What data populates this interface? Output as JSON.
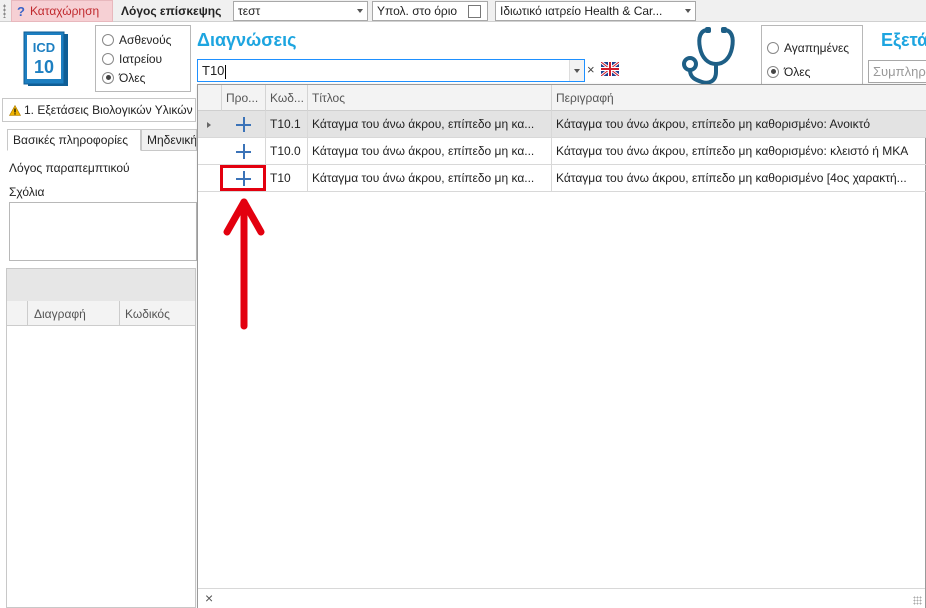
{
  "toolbar": {
    "register_label": "Καταχώρηση",
    "visit_reason_label": "Λόγος επίσκεψης",
    "visit_reason_value": "τεστ",
    "limit_label": "Υπολ. στο όριο",
    "clinic_value": "Ιδιωτικό ιατρείο Health & Car..."
  },
  "icd": {
    "logo_line1": "ICD",
    "logo_line2": "10",
    "filter_options": [
      "Ασθενούς",
      "Ιατρείου",
      "Όλες"
    ],
    "filter_selected": "Όλες",
    "title": "Διαγνώσεις",
    "search_value": "T10",
    "clear_symbol": "×"
  },
  "exams": {
    "filter_options": [
      "Αγαπημένες",
      "Όλες"
    ],
    "filter_selected": "Όλες",
    "title": "Εξετάσ",
    "search_placeholder": "Συμπληρ"
  },
  "left_panel": {
    "tab_label": "1. Εξετάσεις Βιολογικών Υλικών",
    "subtabs": [
      "Βασικές πληροφορίες",
      "Μηδενική"
    ],
    "referral_reason_label": "Λόγος παραπεμπτικού",
    "comments_label": "Σχόλια",
    "grid_columns": [
      "Διαγραφή",
      "Κωδικός"
    ]
  },
  "dropdown_grid": {
    "columns": [
      "Προ...",
      "Κωδ...",
      "Τίτλος",
      "Περιγραφή"
    ],
    "rows": [
      {
        "code": "T10.1",
        "title": "Κάταγμα του άνω άκρου, επίπεδο μη κα...",
        "description": "Κάταγμα του άνω άκρου, επίπεδο μη καθορισμένο: Ανοικτό",
        "selected": true
      },
      {
        "code": "T10.0",
        "title": "Κάταγμα του άνω άκρου, επίπεδο μη κα...",
        "description": "Κάταγμα του άνω άκρου, επίπεδο μη καθορισμένο: κλειστό ή ΜΚΑ",
        "selected": false
      },
      {
        "code": "T10",
        "title": "Κάταγμα του άνω άκρου, επίπεδο μη κα...",
        "description": "Κάταγμα του άνω άκρου, επίπεδο μη καθορισμένο [4ος χαρακτή...",
        "selected": false
      }
    ],
    "footer_close_symbol": "×"
  },
  "colors": {
    "accent_blue": "#1da5e0",
    "annotation_red": "#e3000f",
    "register_text": "#c0282d"
  }
}
